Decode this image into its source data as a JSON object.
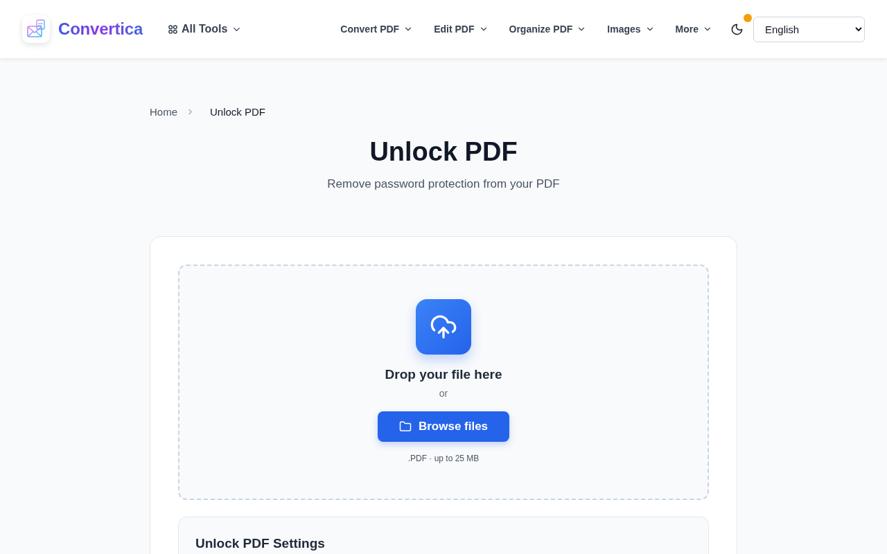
{
  "header": {
    "brand": "Convertica",
    "all_tools": "All Tools",
    "nav": [
      {
        "label": "Convert PDF"
      },
      {
        "label": "Edit PDF"
      },
      {
        "label": "Organize PDF"
      },
      {
        "label": "Images"
      },
      {
        "label": "More"
      }
    ],
    "language": {
      "value": "English"
    }
  },
  "breadcrumb": [
    {
      "label": "Home",
      "current": false
    },
    {
      "label": "Unlock PDF",
      "current": true
    }
  ],
  "title": "Unlock PDF",
  "subtitle": "Remove password protection from your PDF",
  "upload": {
    "heading": "Drop your file here",
    "separator": "or",
    "button": "Browse files",
    "hint": ".PDF · up to 25 MB"
  },
  "settings": {
    "title": "Unlock PDF Settings"
  }
}
